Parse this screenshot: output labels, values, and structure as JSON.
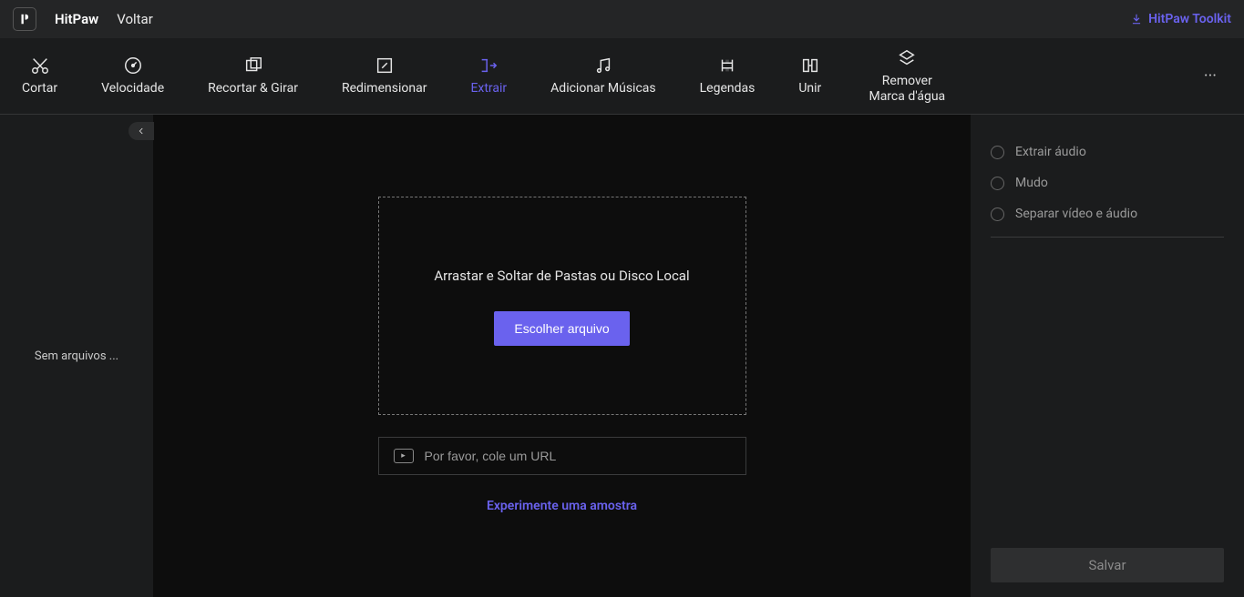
{
  "titlebar": {
    "app_name": "HitPaw",
    "back_label": "Voltar",
    "toolkit_label": "HitPaw Toolkit"
  },
  "toolbar": {
    "items": [
      {
        "label": "Cortar",
        "icon": "scissors"
      },
      {
        "label": "Velocidade",
        "icon": "speed"
      },
      {
        "label": "Recortar & Girar",
        "icon": "crop-rotate"
      },
      {
        "label": "Redimensionar",
        "icon": "resize"
      },
      {
        "label": "Extrair",
        "icon": "extract",
        "active": true
      },
      {
        "label": "Adicionar Músicas",
        "icon": "music"
      },
      {
        "label": "Legendas",
        "icon": "subtitles"
      },
      {
        "label": "Unir",
        "icon": "merge"
      },
      {
        "label": "Remover Marca d'água",
        "icon": "watermark"
      }
    ],
    "more_label": "···"
  },
  "left_panel": {
    "empty_text": "Sem arquivos ..."
  },
  "center": {
    "drop_text": "Arrastar e Soltar de Pastas ou Disco Local",
    "choose_label": "Escolher arquivo",
    "url_placeholder": "Por favor, cole um URL",
    "sample_label": "Experimente uma amostra"
  },
  "right_panel": {
    "options": [
      {
        "label": "Extrair áudio"
      },
      {
        "label": "Mudo"
      },
      {
        "label": "Separar vídeo e áudio"
      }
    ],
    "save_label": "Salvar"
  },
  "colors": {
    "accent": "#6a62ee"
  }
}
